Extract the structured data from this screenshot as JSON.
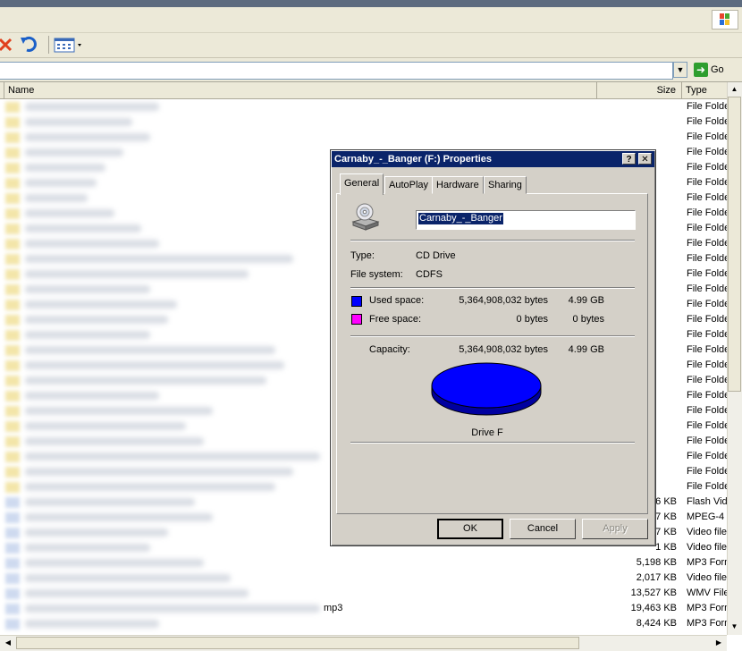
{
  "window": {
    "go_label": "Go"
  },
  "list": {
    "col_name": "Name",
    "col_size": "Size",
    "col_type": "Type",
    "folder_type": "File Folde",
    "files": [
      {
        "size": "6 KB",
        "type": "Flash Vide"
      },
      {
        "size": "7 KB",
        "type": "MPEG-4 v"
      },
      {
        "size": "7 KB",
        "type": "Video file"
      },
      {
        "size": "1 KB",
        "type": "Video file"
      },
      {
        "size": "5,198 KB",
        "type": "MP3 Form"
      },
      {
        "size": "2,017 KB",
        "type": "Video file"
      },
      {
        "size": "13,527 KB",
        "type": "WMV File"
      },
      {
        "size": "19,463 KB",
        "type": "MP3 Form"
      },
      {
        "size": "8,424 KB",
        "type": "MP3 Form"
      }
    ],
    "partial_name": "mp3"
  },
  "dialog": {
    "title": "Carnaby_-_Banger (F:) Properties",
    "help_glyph": "?",
    "close_glyph": "✕",
    "tabs": [
      "General",
      "AutoPlay",
      "Hardware",
      "Sharing"
    ],
    "volume_name": "Carnaby_-_Banger",
    "type_label": "Type:",
    "type_value": "CD Drive",
    "fs_label": "File system:",
    "fs_value": "CDFS",
    "used_label": "Used space:",
    "used_bytes": "5,364,908,032 bytes",
    "used_gb": "4.99 GB",
    "free_label": "Free space:",
    "free_bytes": "0 bytes",
    "free_gb": "0 bytes",
    "capacity_label": "Capacity:",
    "capacity_bytes": "5,364,908,032 bytes",
    "capacity_gb": "4.99 GB",
    "drive_label": "Drive F",
    "used_fraction": 1.0,
    "ok": "OK",
    "cancel": "Cancel",
    "apply": "Apply"
  },
  "colors": {
    "used": "#0000ff",
    "free": "#ff00ff",
    "title_bar": "#0a246a"
  }
}
